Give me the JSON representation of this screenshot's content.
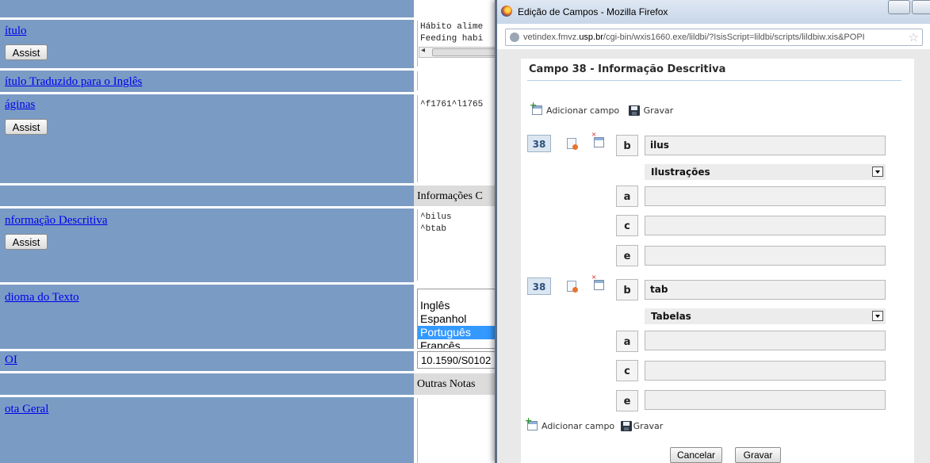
{
  "form": {
    "titulo_label": "ítulo",
    "titulo_value_lines": [
      "Hábito alime",
      "Feeding habi"
    ],
    "titulo_traduzido_label": "ítulo Traduzido para o Inglês",
    "paginas_label": "áginas",
    "paginas_value": "^f1761^l1765",
    "section_informacoes": "Informações C",
    "info_descritiva_label": "nformação Descritiva",
    "info_descritiva_lines": [
      "^bilus",
      "^btab"
    ],
    "idioma_label": "dioma do Texto",
    "idioma_options": [
      "Inglês",
      "Espanhol",
      "Português",
      "Francês"
    ],
    "idioma_selected": "Português",
    "doi_label": "OI",
    "doi_value": "10.1590/S0102",
    "section_outras": "Outras Notas",
    "nota_geral_label": "ota Geral",
    "assist_label": "Assist"
  },
  "window": {
    "title": "Edição de Campos - Mozilla Firefox",
    "url_prefix": "vetindex.fmvz.",
    "url_domain": "usp.br",
    "url_rest": "/cgi-bin/wxis1660.exe/lildbi/?IsisScript=lildbi/scripts/lildbiw.xis&POPI"
  },
  "popup": {
    "heading": "Campo 38 - Informação Descritiva",
    "add_field_label": "Adicionar campo",
    "save_label": "Gravar",
    "cancel_button": "Cancelar",
    "save_button": "Gravar",
    "occurrences": [
      {
        "tag": "38",
        "b_label": "b",
        "b_value": "ilus",
        "select_value": "Ilustrações",
        "a_label": "a",
        "a_value": "",
        "c_label": "c",
        "c_value": "",
        "e_label": "e",
        "e_value": ""
      },
      {
        "tag": "38",
        "b_label": "b",
        "b_value": "tab",
        "select_value": "Tabelas",
        "a_label": "a",
        "a_value": "",
        "c_label": "c",
        "c_value": "",
        "e_label": "e",
        "e_value": ""
      }
    ]
  }
}
